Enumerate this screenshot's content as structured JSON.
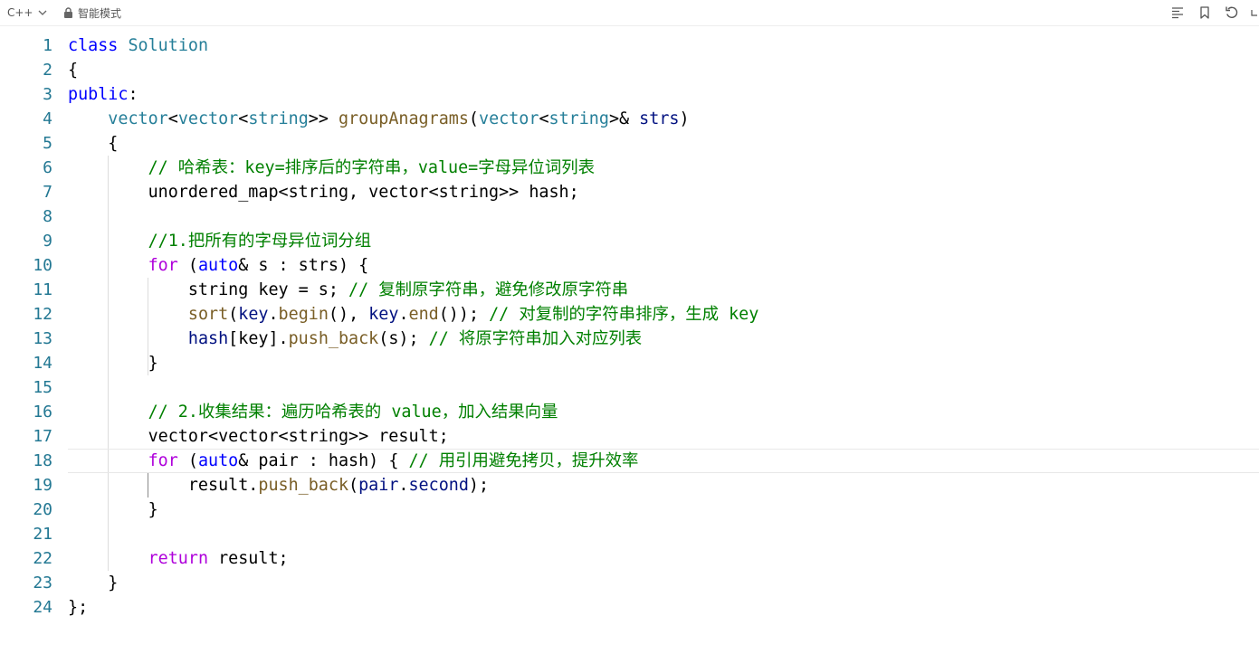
{
  "toolbar": {
    "language": "C++",
    "mode_label": "智能模式",
    "icons": [
      "chevron-down-icon",
      "lock-icon",
      "format-icon",
      "bookmark-icon",
      "reset-icon",
      "collapse-icon"
    ]
  },
  "colors": {
    "keyword": "#0000ff",
    "control": "#af00db",
    "type": "#267f99",
    "function": "#795e26",
    "variable": "#001080",
    "comment": "#008000",
    "line_number": "#237893"
  },
  "editor": {
    "line_numbers": [
      "1",
      "2",
      "3",
      "4",
      "5",
      "6",
      "7",
      "8",
      "9",
      "10",
      "11",
      "12",
      "13",
      "14",
      "15",
      "16",
      "17",
      "18",
      "19",
      "20",
      "21",
      "22",
      "23",
      "24"
    ],
    "active_line": "18",
    "lines": [
      [
        {
          "t": "class",
          "c": "kw"
        },
        {
          "t": " "
        },
        {
          "t": "Solution",
          "c": "ty"
        }
      ],
      [
        {
          "t": "{"
        }
      ],
      [
        {
          "t": "public",
          "c": "kw"
        },
        {
          "t": ":"
        }
      ],
      [
        {
          "t": "    "
        },
        {
          "t": "vector",
          "c": "ty"
        },
        {
          "t": "<"
        },
        {
          "t": "vector",
          "c": "ty"
        },
        {
          "t": "<"
        },
        {
          "t": "string",
          "c": "ty"
        },
        {
          "t": ">> "
        },
        {
          "t": "groupAnagrams",
          "c": "fn"
        },
        {
          "t": "("
        },
        {
          "t": "vector",
          "c": "ty"
        },
        {
          "t": "<"
        },
        {
          "t": "string",
          "c": "ty"
        },
        {
          "t": ">& "
        },
        {
          "t": "strs",
          "c": "var"
        },
        {
          "t": ")"
        }
      ],
      [
        {
          "t": "    {"
        }
      ],
      [
        {
          "t": "        "
        },
        {
          "t": "// 哈希表：key=排序后的字符串，value=字母异位词列表",
          "c": "cm"
        }
      ],
      [
        {
          "t": "        unordered_map<string, vector<string>> hash;"
        }
      ],
      [
        {
          "t": ""
        }
      ],
      [
        {
          "t": "        "
        },
        {
          "t": "//1.把所有的字母异位词分组",
          "c": "cm"
        }
      ],
      [
        {
          "t": "        "
        },
        {
          "t": "for",
          "c": "ctl"
        },
        {
          "t": " ("
        },
        {
          "t": "auto",
          "c": "kw"
        },
        {
          "t": "& s : strs) {"
        }
      ],
      [
        {
          "t": "            string key = s; "
        },
        {
          "t": "// 复制原字符串，避免修改原字符串",
          "c": "cm"
        }
      ],
      [
        {
          "t": "            "
        },
        {
          "t": "sort",
          "c": "fn"
        },
        {
          "t": "("
        },
        {
          "t": "key",
          "c": "var"
        },
        {
          "t": "."
        },
        {
          "t": "begin",
          "c": "fn"
        },
        {
          "t": "(), "
        },
        {
          "t": "key",
          "c": "var"
        },
        {
          "t": "."
        },
        {
          "t": "end",
          "c": "fn"
        },
        {
          "t": "()); "
        },
        {
          "t": "// 对复制的字符串排序，生成 key",
          "c": "cm"
        }
      ],
      [
        {
          "t": "            "
        },
        {
          "t": "hash",
          "c": "var"
        },
        {
          "t": "[key]."
        },
        {
          "t": "push_back",
          "c": "fn"
        },
        {
          "t": "(s); "
        },
        {
          "t": "// 将原字符串加入对应列表",
          "c": "cm"
        }
      ],
      [
        {
          "t": "        }"
        }
      ],
      [
        {
          "t": ""
        }
      ],
      [
        {
          "t": "        "
        },
        {
          "t": "// 2.收集结果：遍历哈希表的 value，加入结果向量",
          "c": "cm"
        }
      ],
      [
        {
          "t": "        vector<vector<string>> result;"
        }
      ],
      [
        {
          "t": "        "
        },
        {
          "t": "for",
          "c": "ctl"
        },
        {
          "t": " ("
        },
        {
          "t": "auto",
          "c": "kw"
        },
        {
          "t": "& pair : hash) { "
        },
        {
          "t": "// 用引用避免拷贝，提升效率",
          "c": "cm"
        }
      ],
      [
        {
          "t": "            result."
        },
        {
          "t": "push_back",
          "c": "fn"
        },
        {
          "t": "("
        },
        {
          "t": "pair",
          "c": "var"
        },
        {
          "t": "."
        },
        {
          "t": "second",
          "c": "var"
        },
        {
          "t": ");"
        }
      ],
      [
        {
          "t": "        }"
        }
      ],
      [
        {
          "t": ""
        }
      ],
      [
        {
          "t": "        "
        },
        {
          "t": "return",
          "c": "ctl"
        },
        {
          "t": " result;"
        }
      ],
      [
        {
          "t": "    }"
        }
      ],
      [
        {
          "t": "};"
        }
      ]
    ]
  }
}
